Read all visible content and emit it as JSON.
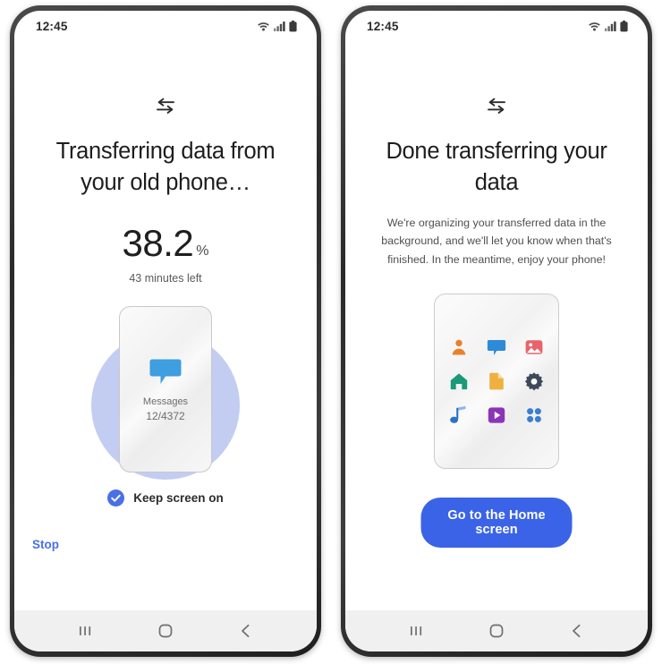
{
  "meta": {
    "colors": {
      "accent_blue": "#3a63e8",
      "link_blue": "#4a6fe8",
      "halo_blue": "#c3cdf2",
      "navbar_gray": "#f0f0f0",
      "text_primary": "#1d1d1d",
      "text_secondary": "#5a5a5a"
    }
  },
  "left_phone": {
    "status_bar": {
      "clock": "12:45",
      "icons": [
        "wifi-icon",
        "signal-icon",
        "battery-icon"
      ]
    },
    "header_icon": "transfer-swap-icon",
    "headline": "Transferring data from your old phone…",
    "progress": {
      "value": "38.2",
      "unit": "%",
      "eta": "43 minutes left"
    },
    "illustration": {
      "halo": "blue-circle",
      "device": "mini-phone-card",
      "app_icon": "message-bubble-icon",
      "app_name": "Messages",
      "app_count": "12/4372"
    },
    "keep_screen_on": {
      "checkbox_icon": "check-circle-icon",
      "label": "Keep screen on",
      "checked": true
    },
    "stop_label": "Stop",
    "nav_bar": {
      "recents": "recents-icon",
      "home": "home-icon",
      "back": "back-icon"
    }
  },
  "right_phone": {
    "status_bar": {
      "clock": "12:45",
      "icons": [
        "wifi-icon",
        "signal-icon",
        "battery-icon"
      ]
    },
    "header_icon": "transfer-swap-icon",
    "headline": "Done transferring your data",
    "body": "We're organizing your transferred data in the background, and we'll let you know when that's finished. In the meantime, enjoy your phone!",
    "illustration": {
      "device": "mini-phone-card",
      "apps": [
        {
          "name": "contacts-icon",
          "color": "#e8822a"
        },
        {
          "name": "messages-icon",
          "color": "#2d8ad6"
        },
        {
          "name": "gallery-icon",
          "color": "#e8646a"
        },
        {
          "name": "home-app-icon",
          "color": "#1a9a78"
        },
        {
          "name": "documents-icon",
          "color": "#f0b040"
        },
        {
          "name": "settings-icon",
          "color": "#3e4a59"
        },
        {
          "name": "music-icon",
          "color": "#2a72c8"
        },
        {
          "name": "video-icon",
          "color": "#8c34b8"
        },
        {
          "name": "apps-icon",
          "color": "#3a7fd0"
        }
      ]
    },
    "primary_button": "Go to the Home screen",
    "nav_bar": {
      "recents": "recents-icon",
      "home": "home-icon",
      "back": "back-icon"
    }
  }
}
